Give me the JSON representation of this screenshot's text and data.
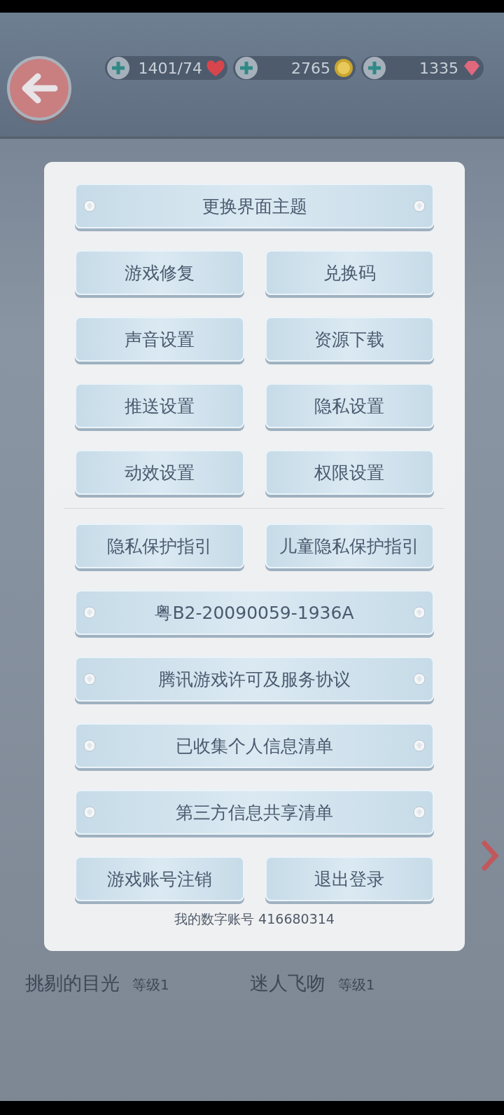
{
  "top_bar": {
    "counters": [
      {
        "kind": "heart",
        "value": "1401/74"
      },
      {
        "kind": "coin",
        "value": "2765"
      },
      {
        "kind": "gem",
        "value": "1335"
      }
    ]
  },
  "skills": [
    {
      "name": "挑剔的目光",
      "level": "等级1"
    },
    {
      "name": "迷人飞吻",
      "level": "等级1"
    }
  ],
  "settings_dialog": {
    "rows": [
      {
        "kind": "wide",
        "buttons": [
          "更换界面主题"
        ]
      },
      {
        "kind": "pair",
        "buttons": [
          "游戏修复",
          "兑换码"
        ]
      },
      {
        "kind": "pair",
        "buttons": [
          "声音设置",
          "资源下载"
        ]
      },
      {
        "kind": "pair",
        "buttons": [
          "推送设置",
          "隐私设置"
        ]
      },
      {
        "kind": "pair",
        "buttons": [
          "动效设置",
          "权限设置"
        ]
      },
      {
        "kind": "divider",
        "buttons": []
      },
      {
        "kind": "pair",
        "buttons": [
          "隐私保护指引",
          "儿童隐私保护指引"
        ]
      },
      {
        "kind": "wide",
        "buttons": [
          "粤B2-20090059-1936A"
        ]
      },
      {
        "kind": "wide",
        "buttons": [
          "腾讯游戏许可及服务协议"
        ]
      },
      {
        "kind": "wide",
        "buttons": [
          "已收集个人信息清单"
        ]
      },
      {
        "kind": "wide",
        "buttons": [
          "第三方信息共享清单"
        ]
      },
      {
        "kind": "pair",
        "buttons": [
          "游戏账号注销",
          "退出登录"
        ]
      }
    ],
    "account_label": "我的数字账号 416680314"
  }
}
